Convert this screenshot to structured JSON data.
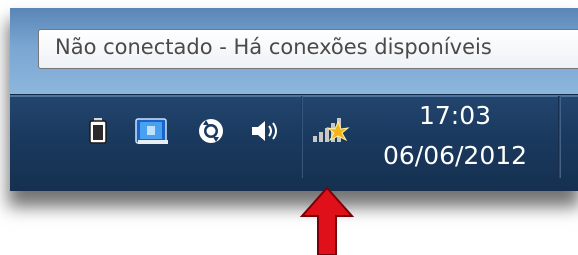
{
  "tooltip": {
    "text": "Não conectado - Há conexões disponíveis"
  },
  "clock": {
    "time": "17:03",
    "date": "06/06/2012"
  },
  "tray_icons": [
    {
      "icon": "battery-icon"
    },
    {
      "icon": "action-center-icon"
    },
    {
      "icon": "sync-icon"
    },
    {
      "icon": "volume-icon"
    },
    {
      "icon": "network-wireless-icon"
    }
  ],
  "colors": {
    "taskbar": "#1b3a60",
    "arrow": "#e0101a",
    "network_star": "#f6b41a"
  }
}
